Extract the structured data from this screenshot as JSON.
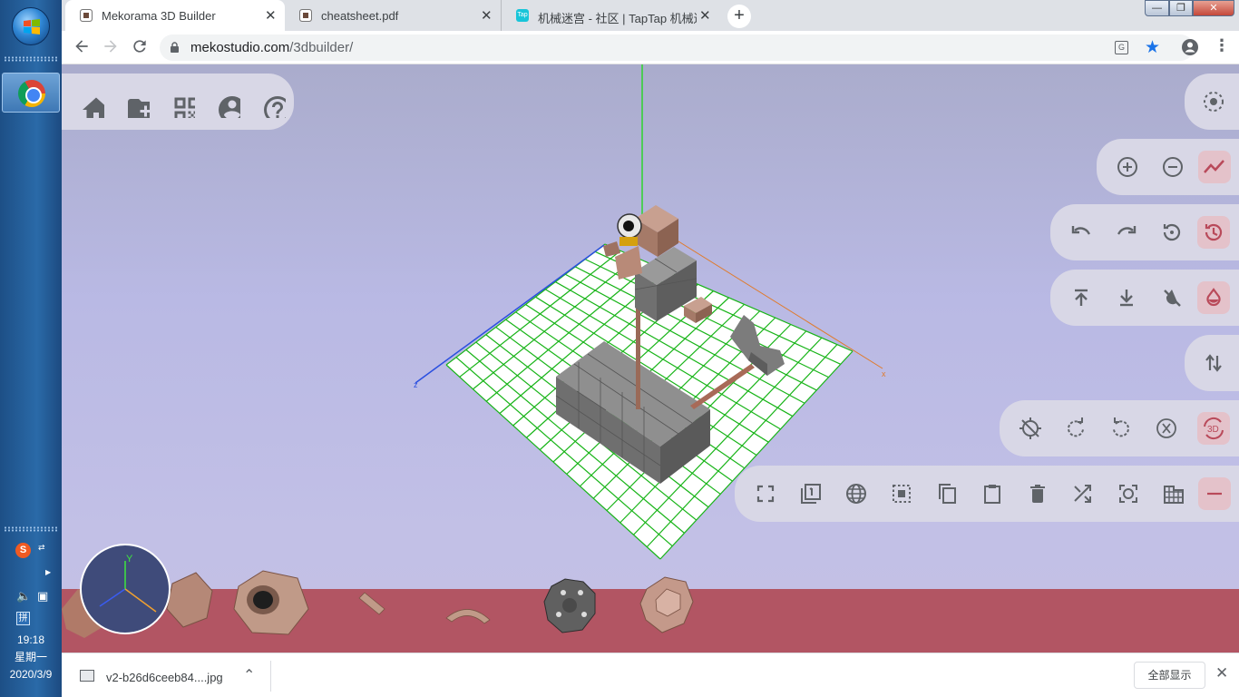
{
  "taskbar": {
    "clock_time": "19:18",
    "clock_day": "星期一",
    "clock_date": "2020/3/9",
    "ime_label": "S",
    "ime_mode": "拼"
  },
  "tabs": [
    {
      "title": "Mekorama 3D Builder",
      "active": true
    },
    {
      "title": "cheatsheet.pdf",
      "active": false
    },
    {
      "title": "机械迷宫 - 社区 | TapTap 机械迷宫社区",
      "active": false
    }
  ],
  "tab_favicons": {
    "taptap": "Tap"
  },
  "new_tab_label": "+",
  "window_controls": {
    "minimize": "—",
    "maximize": "❐",
    "close": "✕"
  },
  "toolbar": {
    "url_domain": "mekostudio.com",
    "url_path": "/3dbuilder/",
    "menu_glyph": "⋮"
  },
  "scene": {
    "axis_x_label": "x",
    "axis_z_label": "z",
    "gizmo_y_label": "Y",
    "accent_active": "#e4c2ca",
    "floor_color": "#b25563",
    "grid_color": "#18b418"
  },
  "top_left_panel": {
    "buttons": [
      "home-icon",
      "new-folder-icon",
      "qr-code-icon",
      "account-icon",
      "help-icon"
    ]
  },
  "right_panels": {
    "focus": [
      "focus-icon"
    ],
    "zoom": [
      "zoom-in-icon",
      "zoom-out-icon",
      "trend-icon"
    ],
    "history": [
      "undo-icon",
      "redo-icon",
      "restore-icon",
      "history-icon"
    ],
    "layer": [
      "upload-icon",
      "download-icon",
      "no-color-icon",
      "fill-icon"
    ],
    "swap": [
      "swap-vertical-icon"
    ],
    "rotate": [
      "gps-off-icon",
      "rotate-right-icon",
      "rotate-left-icon",
      "x-axis-icon",
      "3d-rotation-icon"
    ],
    "rotate_3d_label": "3D",
    "edit": [
      "fullscreen-icon",
      "filter-1-icon",
      "globe-icon",
      "select-all-icon",
      "copy-icon",
      "paste-icon",
      "delete-icon",
      "shuffle-icon",
      "center-focus-icon",
      "grid-icon",
      "minus-icon"
    ]
  },
  "downloads": {
    "file_name": "v2-b26d6ceeb84....jpg",
    "show_all": "全部显示",
    "close": "✕"
  }
}
